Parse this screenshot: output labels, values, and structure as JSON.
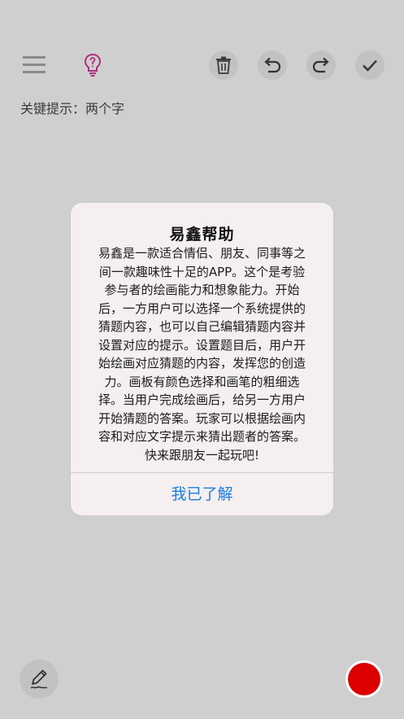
{
  "toolbar": {
    "menu_icon": "menu-icon",
    "hint_icon": "lightbulb-icon",
    "delete_icon": "trash-icon",
    "undo_icon": "undo-icon",
    "redo_icon": "redo-icon",
    "confirm_icon": "check-icon",
    "hint_icon_color": "#b0307a"
  },
  "hint": {
    "text": "关键提示：两个字"
  },
  "dialog": {
    "title": "易鑫帮助",
    "body_lines": [
      "易鑫是一款适合情侣、朋友、同事等之",
      "间一款趣味性十足的APP。这个是考验",
      "参与者的绘画能力和想象能力。开始",
      "后，一方用户可以选择一个系统提供的",
      "猜题内容，也可以自己编辑猜题内容并",
      "设置对应的提示。设置题目后，用户开",
      "始绘画对应猜题的内容，发挥您的创造",
      "力。画板有颜色选择和画笔的粗细选",
      "择。当用户完成绘画后，给另一方用户",
      "开始猜题的答案。玩家可以根据绘画内",
      "容和对应文字提示来猜出题者的答案。",
      "快来跟朋友一起玩吧!"
    ],
    "ok_label": "我已了解",
    "ok_color": "#1a7de0"
  },
  "bottom": {
    "pen_icon": "pen-icon",
    "selected_color": "#dd0000"
  }
}
